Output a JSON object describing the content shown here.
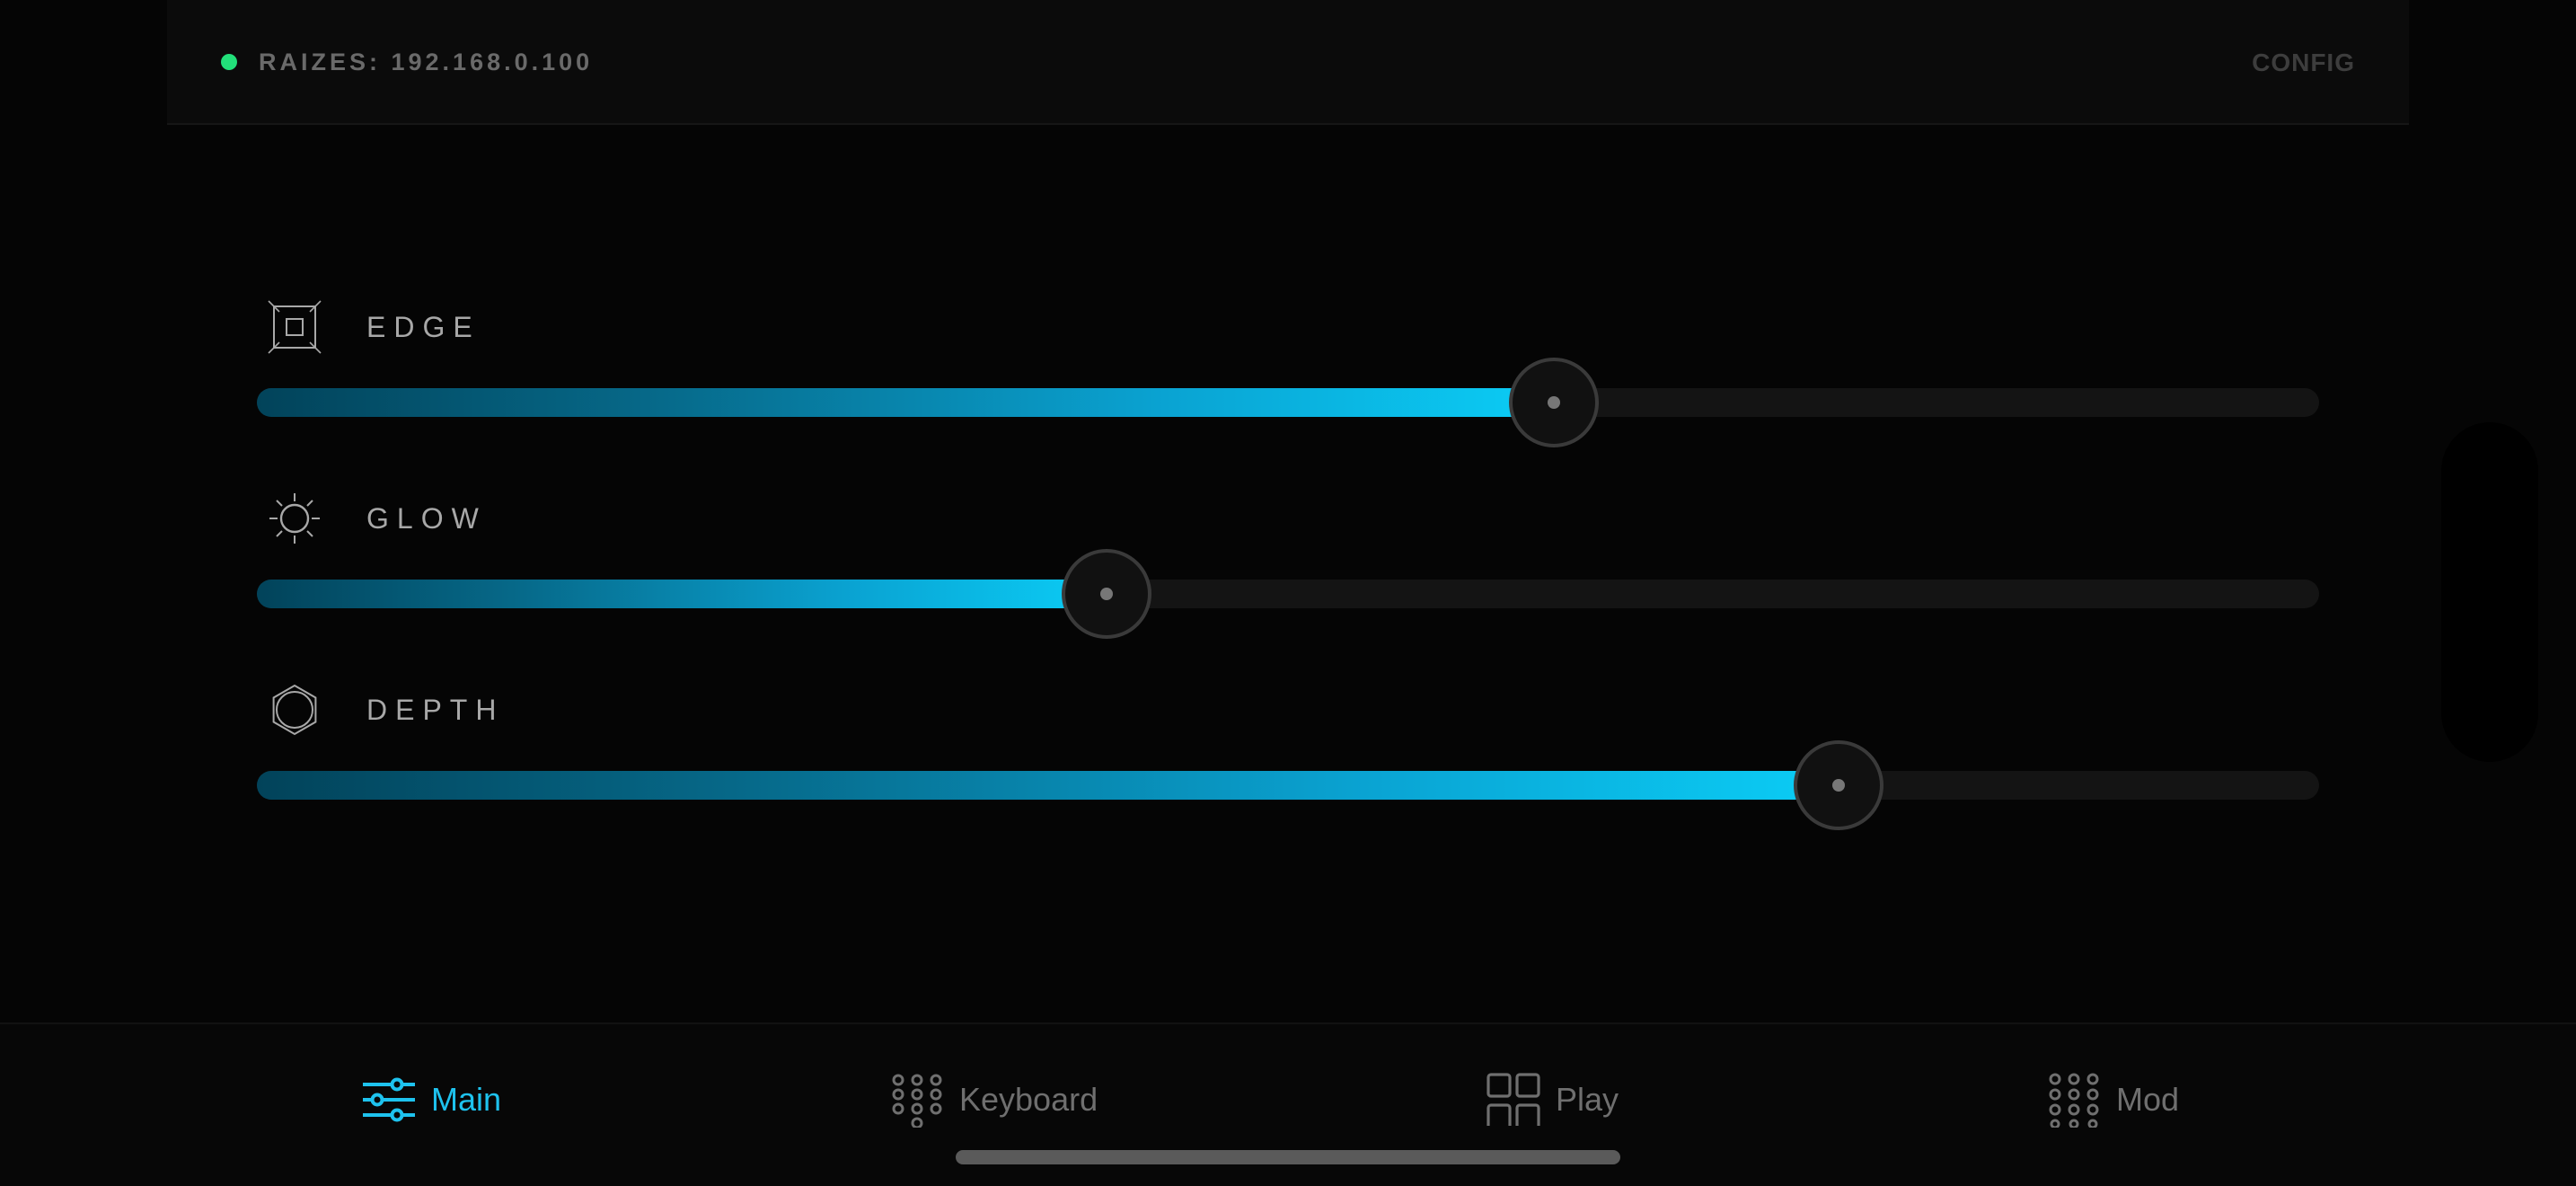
{
  "header": {
    "status_color": "#22e07a",
    "connection_label": "RAIZES: 192.168.0.100",
    "config_label": "CONFIG"
  },
  "sliders": [
    {
      "id": "edge",
      "label": "EDGE",
      "icon": "square-frame-icon",
      "value": 0.629
    },
    {
      "id": "glow",
      "label": "GLOW",
      "icon": "sun-icon",
      "value": 0.412
    },
    {
      "id": "depth",
      "label": "DEPTH",
      "icon": "hexagon-icon",
      "value": 0.767
    }
  ],
  "colors": {
    "accent": "#0bcdf6",
    "accent_dark": "#02435a",
    "background": "#050505"
  },
  "tabs": [
    {
      "id": "main",
      "label": "Main",
      "icon": "sliders-icon",
      "active": true
    },
    {
      "id": "keyboard",
      "label": "Keyboard",
      "icon": "keypad-icon",
      "active": false
    },
    {
      "id": "play",
      "label": "Play",
      "icon": "grid-icon",
      "active": false
    },
    {
      "id": "mod",
      "label": "Mod",
      "icon": "dots-grid-icon",
      "active": false
    }
  ]
}
